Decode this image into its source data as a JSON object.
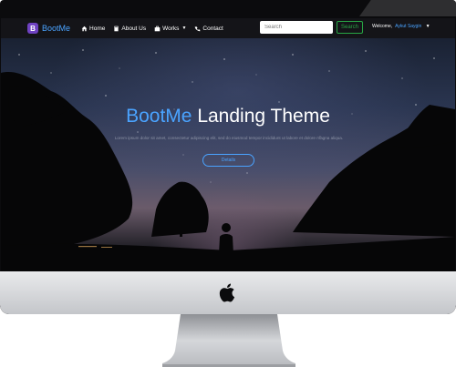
{
  "brand": {
    "logo_letter": "B",
    "name": "BootMe",
    "accent_color": "#4aa3ff",
    "logo_color": "#6f42c1"
  },
  "nav": {
    "items": [
      {
        "label": "Home",
        "icon": "home-icon"
      },
      {
        "label": "About Us",
        "icon": "book-icon"
      },
      {
        "label": "Works",
        "icon": "briefcase-icon",
        "dropdown": true
      },
      {
        "label": "Contact",
        "icon": "phone-icon"
      }
    ]
  },
  "search": {
    "placeholder": "Search",
    "button_label": "Search"
  },
  "user": {
    "welcome": "Welcome,",
    "name": "Aykut Saygin"
  },
  "hero": {
    "title_accent": "BootMe",
    "title_rest": " Landing Theme",
    "text": "Lorem ipsum dolor sit amet, consectetur adipiscing elit, sed do eiusmod tempor incididunt ut labore et dolore magna aliqua.",
    "button_label": "Details"
  }
}
